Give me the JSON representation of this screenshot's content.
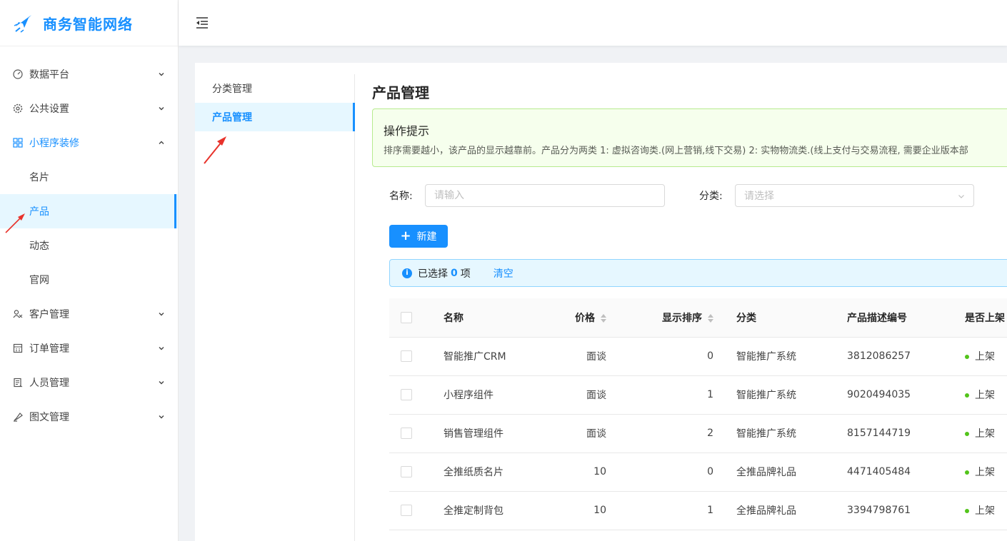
{
  "app": {
    "title": "商务智能网络"
  },
  "sidebar": {
    "items": [
      {
        "label": "数据平台",
        "icon": "dashboard-icon"
      },
      {
        "label": "公共设置",
        "icon": "gear-icon"
      },
      {
        "label": "小程序装修",
        "icon": "appstore-icon",
        "expanded": true,
        "children": [
          {
            "label": "名片"
          },
          {
            "label": "产品",
            "selected": true
          },
          {
            "label": "动态"
          },
          {
            "label": "官网"
          }
        ]
      },
      {
        "label": "客户管理",
        "icon": "users-icon"
      },
      {
        "label": "订单管理",
        "icon": "calculator-icon"
      },
      {
        "label": "人员管理",
        "icon": "id-card-icon"
      },
      {
        "label": "图文管理",
        "icon": "highlight-icon"
      }
    ]
  },
  "content_menu": {
    "items": [
      {
        "label": "分类管理"
      },
      {
        "label": "产品管理",
        "selected": true
      }
    ]
  },
  "main": {
    "title": "产品管理",
    "notice": {
      "title": "操作提示",
      "desc": "排序需要越小，该产品的显示越靠前。产品分为两类 1: 虚拟咨询类.(网上营销,线下交易) 2: 实物物流类.(线上支付与交易流程, 需要企业版本部"
    },
    "filters": {
      "name_label": "名称:",
      "name_placeholder": "请输入",
      "category_label": "分类:",
      "category_placeholder": "请选择"
    },
    "new_button": "新建",
    "selection": {
      "prefix": "已选择",
      "count": "0",
      "suffix": "项",
      "clear": "清空"
    },
    "table": {
      "columns": [
        "名称",
        "价格",
        "显示排序",
        "分类",
        "产品描述编号",
        "是否上架"
      ],
      "rows": [
        {
          "name": "智能推广CRM",
          "price": "面谈",
          "order": "0",
          "category": "智能推广系统",
          "code": "3812086257",
          "status": "上架"
        },
        {
          "name": "小程序组件",
          "price": "面谈",
          "order": "1",
          "category": "智能推广系统",
          "code": "9020494035",
          "status": "上架"
        },
        {
          "name": "销售管理组件",
          "price": "面谈",
          "order": "2",
          "category": "智能推广系统",
          "code": "8157144719",
          "status": "上架"
        },
        {
          "name": "全推纸质名片",
          "price": "10",
          "order": "0",
          "category": "全推品牌礼品",
          "code": "4471405484",
          "status": "上架"
        },
        {
          "name": "全推定制背包",
          "price": "10",
          "order": "1",
          "category": "全推品牌礼品",
          "code": "3394798761",
          "status": "上架"
        }
      ]
    }
  },
  "colors": {
    "primary": "#1890ff",
    "success_bg": "#f6ffed",
    "info_bg": "#e6f7ff",
    "status_on": "#52c41a",
    "annotation": "#e8322b"
  }
}
